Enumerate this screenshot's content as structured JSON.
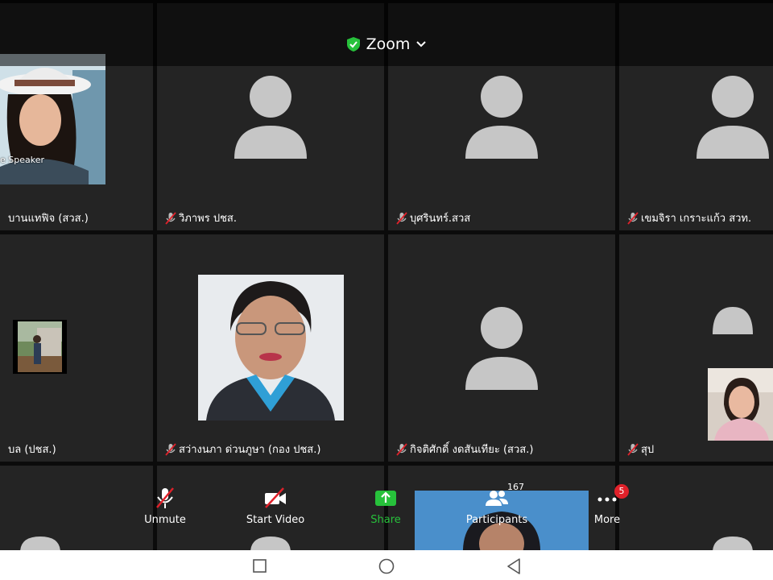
{
  "app": {
    "title": "Zoom"
  },
  "tiles": [
    {
      "name": "บานแทฟิจ (สวส.)",
      "badge": "e Speaker"
    },
    {
      "name": "วิภาพร  ปชส."
    },
    {
      "name": "บุศรินทร์.สวส"
    },
    {
      "name": "เขมจิรา  เกราะแก้ว สวท."
    },
    {
      "name": "บล (ปชส.)"
    },
    {
      "name": "สว่างนภา ด่วนภูษา (กอง ปชส.)"
    },
    {
      "name": "กิจติศักดิ์ งดสันเทียะ (สวส.)"
    },
    {
      "name": "สุป"
    }
  ],
  "toolbar": {
    "unmute": "Unmute",
    "start_video": "Start Video",
    "share": "Share",
    "participants": "Participants",
    "participants_count": "167",
    "more": "More",
    "more_badge": "5"
  },
  "colors": {
    "share_green": "#27c13b",
    "badge_red": "#e0212a",
    "tile_bg": "#242424",
    "avatar_gray": "#c6c6c6"
  }
}
